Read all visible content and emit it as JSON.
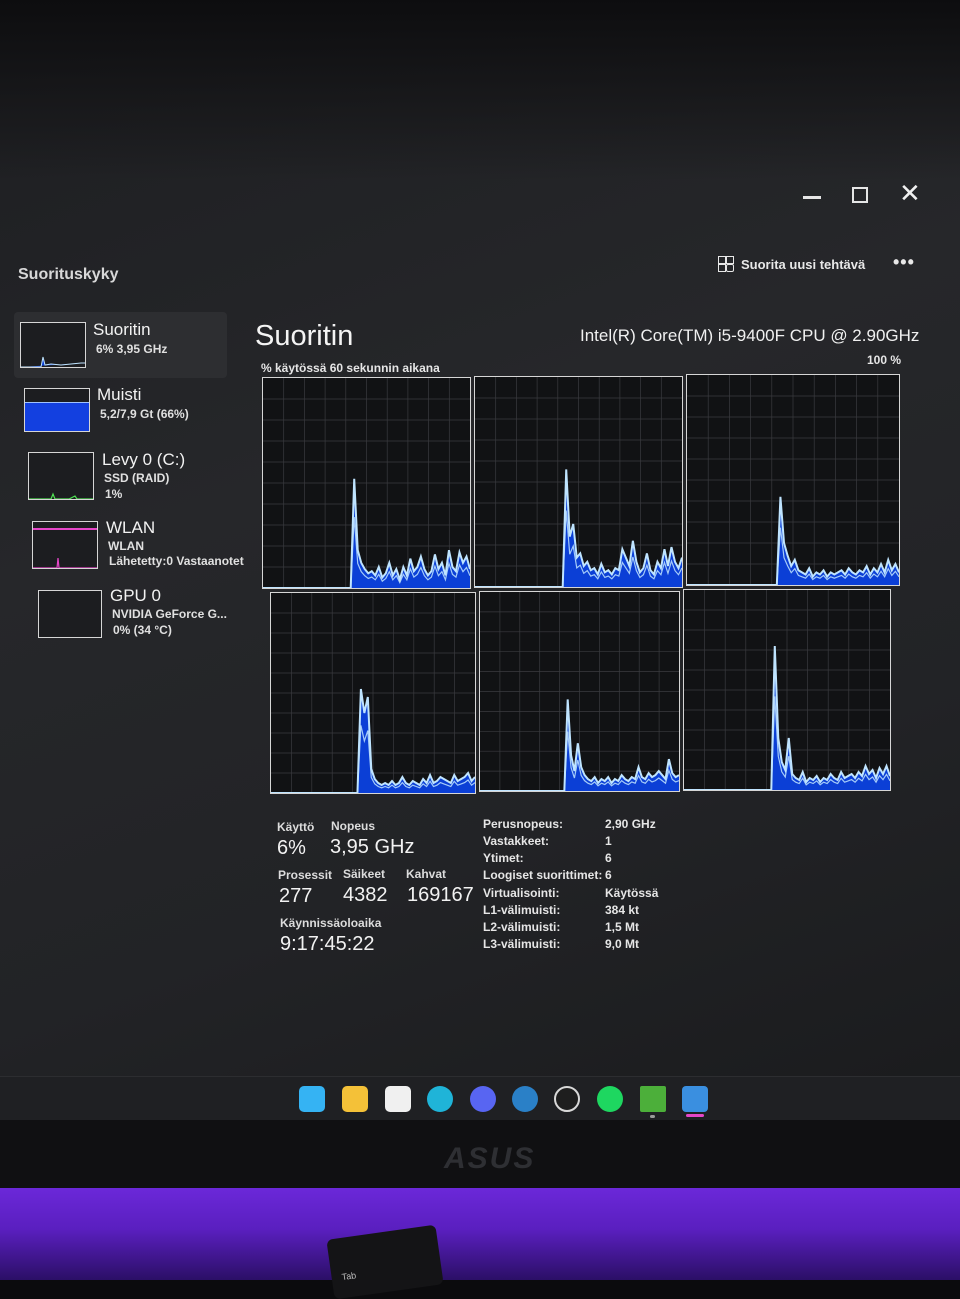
{
  "window": {
    "minimize": "–",
    "maximize": "□",
    "close": "✕"
  },
  "header": {
    "section_title": "Suorituskyky",
    "run_task_label": "Suorita uusi tehtävä",
    "more_label": "•••"
  },
  "sidebar": {
    "items": [
      {
        "name": "Suoritin",
        "sub1": "6% 3,95 GHz",
        "sub2": "",
        "sub3": ""
      },
      {
        "name": "Muisti",
        "sub1": "5,2/7,9 Gt (66%)",
        "sub2": "",
        "sub3": ""
      },
      {
        "name": "Levy 0 (C:)",
        "sub1": "SSD (RAID)",
        "sub2": "1%",
        "sub3": ""
      },
      {
        "name": "WLAN",
        "sub1": "WLAN",
        "sub2": "Lähetetty:0 Vastaanotet",
        "sub3": ""
      },
      {
        "name": "GPU 0",
        "sub1": "NVIDIA GeForce G...",
        "sub2": "0% (34 °C)",
        "sub3": ""
      }
    ],
    "memory_usage_fraction": 0.66
  },
  "main": {
    "title": "Suoritin",
    "cpu_model": "Intel(R) Core(TM) i5-9400F CPU @ 2.90GHz",
    "usage_label": "% käytössä 60 sekunnin aikana",
    "usage_max": "100 %"
  },
  "stats": {
    "usage_label": "Käyttö",
    "usage_value": "6%",
    "speed_label": "Nopeus",
    "speed_value": "3,95 GHz",
    "processes_label": "Prosessit",
    "processes_value": "277",
    "threads_label": "Säikeet",
    "threads_value": "4382",
    "handles_label": "Kahvat",
    "handles_value": "169167",
    "uptime_label": "Käynnissäoloaika",
    "uptime_value": "9:17:45:22"
  },
  "specs": [
    {
      "label": "Perusnopeus:",
      "value": "2,90 GHz"
    },
    {
      "label": "Vastakkeet:",
      "value": "1"
    },
    {
      "label": "Ytimet:",
      "value": "6"
    },
    {
      "label": "Loogiset suorittimet:",
      "value": "6"
    },
    {
      "label": "Virtualisointi:",
      "value": "Käytössä"
    },
    {
      "label": "L1-välimuisti:",
      "value": "384 kt"
    },
    {
      "label": "L2-välimuisti:",
      "value": "1,5 Mt"
    },
    {
      "label": "L3-välimuisti:",
      "value": "9,0 Mt"
    }
  ],
  "cores": [
    [
      0,
      0,
      0,
      0,
      0,
      0,
      0,
      0,
      0,
      0,
      0,
      0,
      0,
      0,
      0,
      0,
      0,
      0,
      0,
      0,
      0,
      0,
      0,
      0,
      0,
      0,
      52,
      18,
      12,
      9,
      7,
      8,
      6,
      10,
      5,
      7,
      12,
      6,
      9,
      4,
      10,
      6,
      14,
      8,
      10,
      15,
      9,
      6,
      8,
      16,
      9,
      12,
      6,
      18,
      10,
      8,
      17,
      12,
      15,
      9
    ],
    [
      0,
      0,
      0,
      0,
      0,
      0,
      0,
      0,
      0,
      0,
      0,
      0,
      0,
      0,
      0,
      0,
      0,
      0,
      0,
      0,
      0,
      0,
      0,
      0,
      0,
      0,
      56,
      24,
      30,
      14,
      16,
      10,
      12,
      8,
      9,
      6,
      11,
      7,
      8,
      6,
      9,
      8,
      18,
      14,
      10,
      22,
      12,
      7,
      9,
      16,
      8,
      6,
      12,
      9,
      18,
      10,
      19,
      12,
      9,
      14
    ],
    [
      0,
      0,
      0,
      0,
      0,
      0,
      0,
      0,
      0,
      0,
      0,
      0,
      0,
      0,
      0,
      0,
      0,
      0,
      0,
      0,
      0,
      0,
      0,
      0,
      0,
      0,
      42,
      20,
      14,
      9,
      12,
      7,
      6,
      5,
      8,
      4,
      6,
      5,
      7,
      4,
      6,
      5,
      6,
      7,
      5,
      8,
      6,
      5,
      7,
      6,
      9,
      5,
      8,
      6,
      10,
      6,
      12,
      7,
      10,
      6
    ],
    [
      0,
      0,
      0,
      0,
      0,
      0,
      0,
      0,
      0,
      0,
      0,
      0,
      0,
      0,
      0,
      0,
      0,
      0,
      0,
      0,
      0,
      0,
      0,
      0,
      0,
      0,
      52,
      40,
      48,
      12,
      7,
      5,
      4,
      5,
      4,
      6,
      4,
      5,
      8,
      5,
      4,
      6,
      5,
      4,
      7,
      5,
      9,
      5,
      6,
      8,
      7,
      6,
      5,
      9,
      6,
      7,
      8,
      10,
      6,
      8
    ],
    [
      0,
      0,
      0,
      0,
      0,
      0,
      0,
      0,
      0,
      0,
      0,
      0,
      0,
      0,
      0,
      0,
      0,
      0,
      0,
      0,
      0,
      0,
      0,
      0,
      0,
      0,
      46,
      18,
      10,
      24,
      12,
      8,
      6,
      5,
      7,
      4,
      6,
      5,
      7,
      4,
      6,
      5,
      8,
      6,
      5,
      7,
      6,
      12,
      7,
      6,
      9,
      7,
      8,
      10,
      8,
      6,
      16,
      9,
      7,
      8
    ],
    [
      0,
      0,
      0,
      0,
      0,
      0,
      0,
      0,
      0,
      0,
      0,
      0,
      0,
      0,
      0,
      0,
      0,
      0,
      0,
      0,
      0,
      0,
      0,
      0,
      0,
      0,
      72,
      26,
      14,
      10,
      26,
      8,
      6,
      5,
      9,
      4,
      6,
      5,
      7,
      4,
      6,
      5,
      8,
      6,
      5,
      9,
      6,
      7,
      8,
      6,
      9,
      7,
      12,
      8,
      10,
      6,
      11,
      8,
      12,
      7
    ]
  ],
  "taskbar": {
    "apps": [
      {
        "icon": "windows-start-icon",
        "color": "#35b3f3"
      },
      {
        "icon": "file-explorer-icon",
        "color": "#f4c138"
      },
      {
        "icon": "microsoft-store-icon",
        "color": "#f0f0f0"
      },
      {
        "icon": "edge-icon",
        "color": "#1fb4d8"
      },
      {
        "icon": "discord-icon",
        "color": "#5865f2"
      },
      {
        "icon": "steam-icon",
        "color": "#2a80c7"
      },
      {
        "icon": "obs-icon",
        "color": "#d8d8d8"
      },
      {
        "icon": "spotify-icon",
        "color": "#1ed760"
      },
      {
        "icon": "minecraft-icon",
        "color": "#4caf3a"
      },
      {
        "icon": "task-manager-icon",
        "color": "#3a8fe0"
      }
    ]
  },
  "monitor": {
    "brand": "ASUS"
  },
  "keyboard": {
    "key_label": "Tab"
  },
  "colors": {
    "graph_fill": "#0b3fd6",
    "graph_line": "#bfe4ff",
    "graph_grid": "#3a3b3f"
  }
}
